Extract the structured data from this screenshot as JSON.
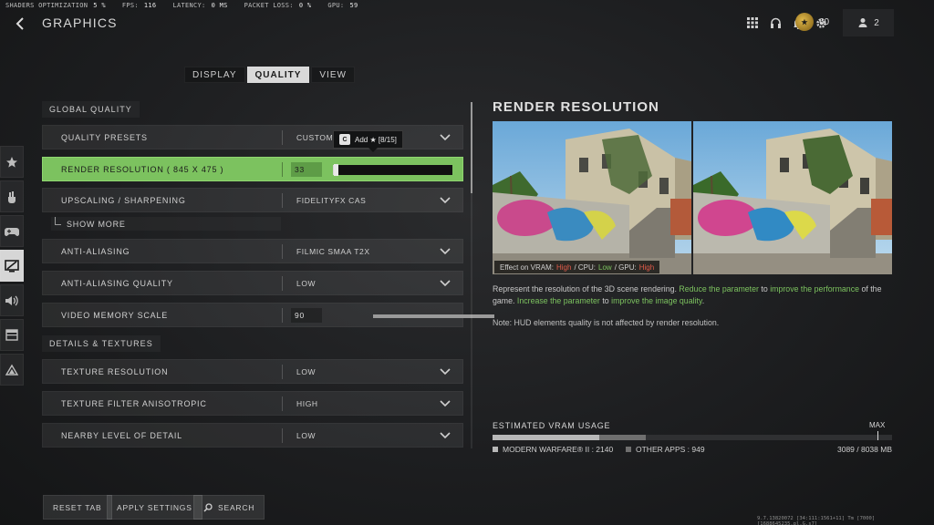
{
  "stats": [
    {
      "label": "SHADERS OPTIMIZATION",
      "value": "5 %"
    },
    {
      "label": "FPS:",
      "value": "116"
    },
    {
      "label": "LATENCY:",
      "value": "0 MS"
    },
    {
      "label": "PACKET LOSS:",
      "value": "0 %"
    },
    {
      "label": "GPU:",
      "value": "59"
    }
  ],
  "header": {
    "title": "GRAPHICS",
    "level": "60",
    "party_count": "2"
  },
  "tabs": [
    {
      "label": "DISPLAY"
    },
    {
      "label": "QUALITY"
    },
    {
      "label": "VIEW"
    }
  ],
  "sections": {
    "global_quality": "GLOBAL QUALITY",
    "details_textures": "DETAILS & TEXTURES"
  },
  "settings": {
    "quality_presets": {
      "label": "QUALITY PRESETS",
      "value": "CUSTOM"
    },
    "render_resolution": {
      "label": "RENDER RESOLUTION ( 845 X 475 )",
      "value": "33",
      "fraction": 0.02
    },
    "upscaling": {
      "label": "UPSCALING / SHARPENING",
      "value": "FIDELITYFX CAS"
    },
    "show_more": "SHOW MORE",
    "anti_aliasing": {
      "label": "ANTI-ALIASING",
      "value": "FILMIC SMAA T2X"
    },
    "anti_aliasing_quality": {
      "label": "ANTI-ALIASING QUALITY",
      "value": "LOW"
    },
    "video_memory_scale": {
      "label": "VIDEO MEMORY SCALE",
      "value": "90",
      "fraction": 1.0
    },
    "texture_resolution": {
      "label": "TEXTURE RESOLUTION",
      "value": "LOW"
    },
    "texture_filter": {
      "label": "TEXTURE FILTER ANISOTROPIC",
      "value": "HIGH"
    },
    "nearby_lod": {
      "label": "NEARBY LEVEL OF DETAIL",
      "value": "LOW"
    }
  },
  "tooltip": {
    "key": "C",
    "text": "Add ★ [8/15]"
  },
  "panel": {
    "title": "RENDER RESOLUTION",
    "effect": {
      "prefix": "Effect on VRAM:",
      "vram": "High",
      "cpu_label": "/ CPU:",
      "cpu": "Low",
      "gpu_label": "/ GPU:",
      "gpu": "High"
    },
    "desc_1": "Represent the resolution of the 3D scene rendering.",
    "desc_2": "Reduce the parameter",
    "desc_3": "to",
    "desc_4": "improve the performance",
    "desc_5": "of the game.",
    "desc_6": "Increase the parameter",
    "desc_7": "to",
    "desc_8": "improve the image quality",
    "desc_9": ".",
    "note": "Note: HUD elements quality is not affected by render resolution."
  },
  "vram": {
    "title": "ESTIMATED VRAM USAGE",
    "max_label": "MAX",
    "mw_label": "MODERN WARFARE® II : 2140",
    "other_label": "OTHER APPS : 949",
    "total": "3089 / 8038 MB",
    "mw_mb": 2140,
    "other_mb": 949,
    "total_mb": 8038,
    "colors": {
      "mw": "#b8b8b8",
      "other": "#6f6f6f"
    }
  },
  "buttons": {
    "reset": "RESET TAB",
    "apply": "APPLY SETTINGS",
    "search": "SEARCH"
  },
  "footer": "9.7.13820072 [34:111:1561+11] Tm [7000][1688645235.pl.G.s7]",
  "accent_color": "#7cc25f"
}
